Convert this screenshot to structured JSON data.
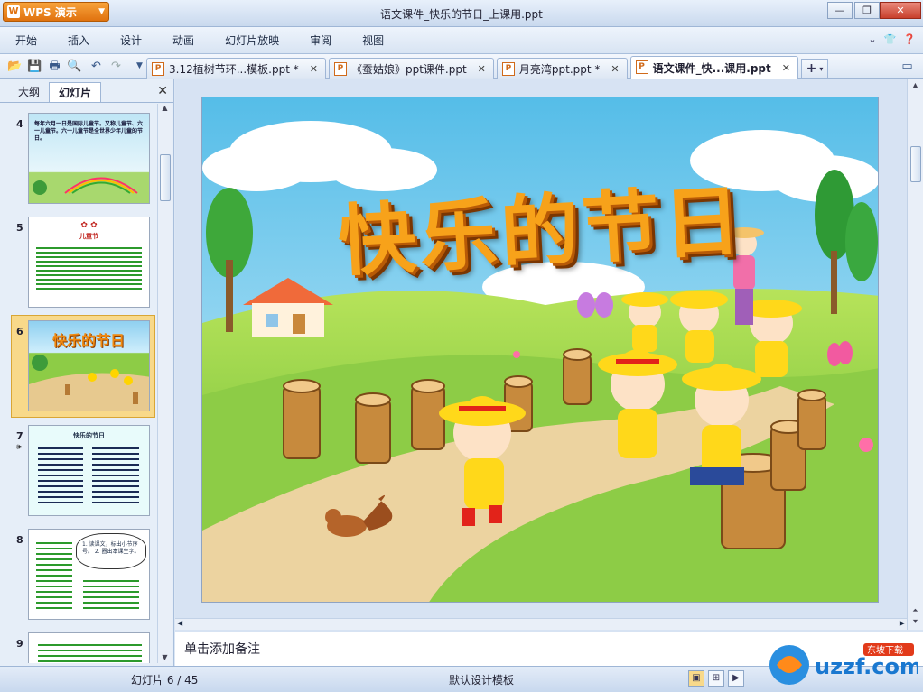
{
  "app": {
    "name": "WPS 演示",
    "window_title": "语文课件_快乐的节日_上课用.ppt"
  },
  "menu": [
    "开始",
    "插入",
    "设计",
    "动画",
    "幻灯片放映",
    "审阅",
    "视图"
  ],
  "tabs": [
    {
      "label": "3.12植树节环...模板.ppt *",
      "active": false
    },
    {
      "label": "《蚕姑娘》ppt课件.ppt",
      "active": false
    },
    {
      "label": "月亮湾ppt.ppt *",
      "active": false
    },
    {
      "label": "语文课件_快...课用.ppt",
      "active": true
    }
  ],
  "sidebar": {
    "tab_outline": "大纲",
    "tab_slides": "幻灯片",
    "thumbs": [
      {
        "num": "4",
        "text": "每年六月一日是国际儿童节。又称儿童节、六一儿童节。六一儿童节是全世界少年儿童的节日。"
      },
      {
        "num": "5",
        "text": "儿童节"
      },
      {
        "num": "6",
        "text": "快乐的节日",
        "selected": true
      },
      {
        "num": "7",
        "text": "快乐的节日"
      },
      {
        "num": "8",
        "text": "1. 读课文，标出小节序号。 2. 圈出本课生字。"
      },
      {
        "num": "9",
        "text": ""
      }
    ]
  },
  "slide": {
    "title": "快乐的节日"
  },
  "notes": {
    "placeholder": "单击添加备注"
  },
  "status": {
    "slide_pos": "幻灯片 6 / 45",
    "template": "默认设计模板"
  },
  "watermark": {
    "brand": "uzzf.com",
    "sub": "东坡下载"
  }
}
